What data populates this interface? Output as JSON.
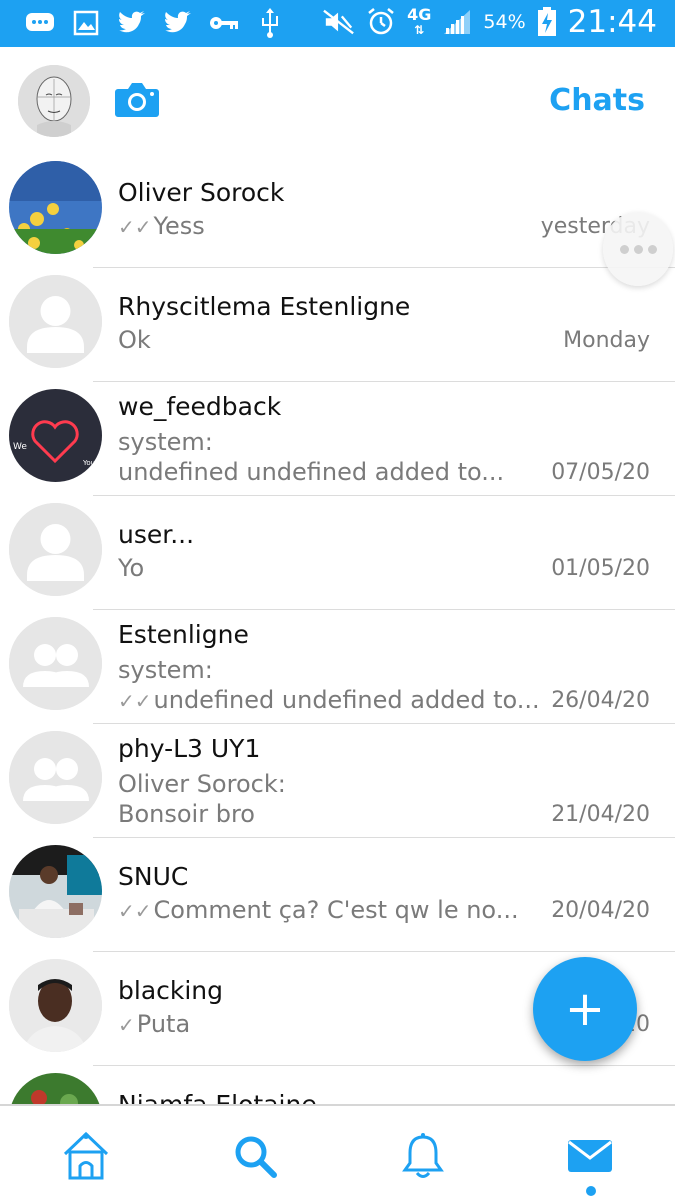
{
  "status_bar": {
    "network": "4G",
    "battery": "54%",
    "time": "21:44"
  },
  "header": {
    "title": "Chats"
  },
  "chats": [
    {
      "name": "Oliver Sorock",
      "line1": "Yess",
      "line2": "",
      "date": "yesterday",
      "tick": "double"
    },
    {
      "name": "Rhyscitlema Estenligne",
      "line1": "Ok",
      "line2": "",
      "date": "Monday",
      "tick": "none"
    },
    {
      "name": "we_feedback",
      "line1": "system:",
      "line2": "undefined undefined added to...",
      "date": "07/05/20",
      "tick": "none"
    },
    {
      "name": "user...",
      "line1": "Yo",
      "line2": "",
      "date": "01/05/20",
      "tick": "none"
    },
    {
      "name": "Estenligne",
      "line1": "system:",
      "line2": "undefined undefined added to...",
      "date": "26/04/20",
      "tick": "double"
    },
    {
      "name": "phy-L3 UY1",
      "line1": "Oliver Sorock:",
      "line2": "Bonsoir bro",
      "date": "21/04/20",
      "tick": "none"
    },
    {
      "name": "SNUC",
      "line1": "Comment ça?  C'est qw le no...",
      "line2": "",
      "date": "20/04/20",
      "tick": "double"
    },
    {
      "name": "blacking",
      "line1": "Puta",
      "line2": "",
      "date": "20",
      "tick": "single"
    },
    {
      "name": "Njamfa Elotaine",
      "line1": "",
      "line2": "",
      "date": "",
      "tick": "none"
    }
  ],
  "fab": {
    "label": "+"
  },
  "bottom_nav": {
    "items": [
      "home-icon",
      "search-icon",
      "bell-icon",
      "mail-icon"
    ],
    "active": "mail-icon"
  },
  "colors": {
    "accent": "#1da1f2",
    "text": "#111111",
    "secondary": "#7a7a7a"
  }
}
